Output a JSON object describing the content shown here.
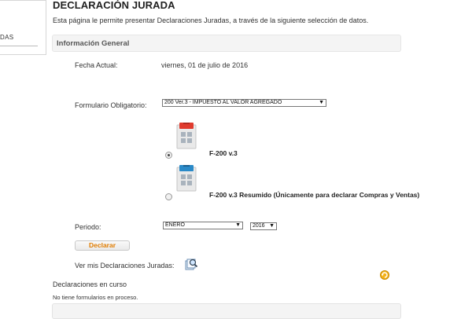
{
  "sidebar": {
    "item_label": "DAS"
  },
  "page": {
    "title": "DECLARACIÓN JURADA",
    "intro": "Esta página le permite presentar Declaraciones Juradas, a través de la siguiente selección de datos."
  },
  "section": {
    "title": "Información General"
  },
  "fecha": {
    "label": "Fecha Actual:",
    "value": "viernes, 01 de julio de 2016"
  },
  "formulario": {
    "label": "Formulario Obligatorio:",
    "selected": "200 Ver.3 - IMPUESTO AL VALOR AGREGADO"
  },
  "options": [
    {
      "label": "F-200 v.3",
      "checked": true,
      "icon_color": "#e03b2e"
    },
    {
      "label": "F-200 v.3 Resumido (Únicamente para declarar Compras y Ventas)",
      "checked": false,
      "icon_color": "#2a8ac8"
    }
  ],
  "periodo": {
    "label": "Periodo:",
    "month": "ENERO",
    "year": "2016"
  },
  "declarar": {
    "label": "Declarar"
  },
  "ver_mis": {
    "label": "Ver mis Declaraciones Juradas:"
  },
  "en_curso": {
    "title": "Declaraciones en curso",
    "empty_text": "No tiene formularios en proceso."
  }
}
